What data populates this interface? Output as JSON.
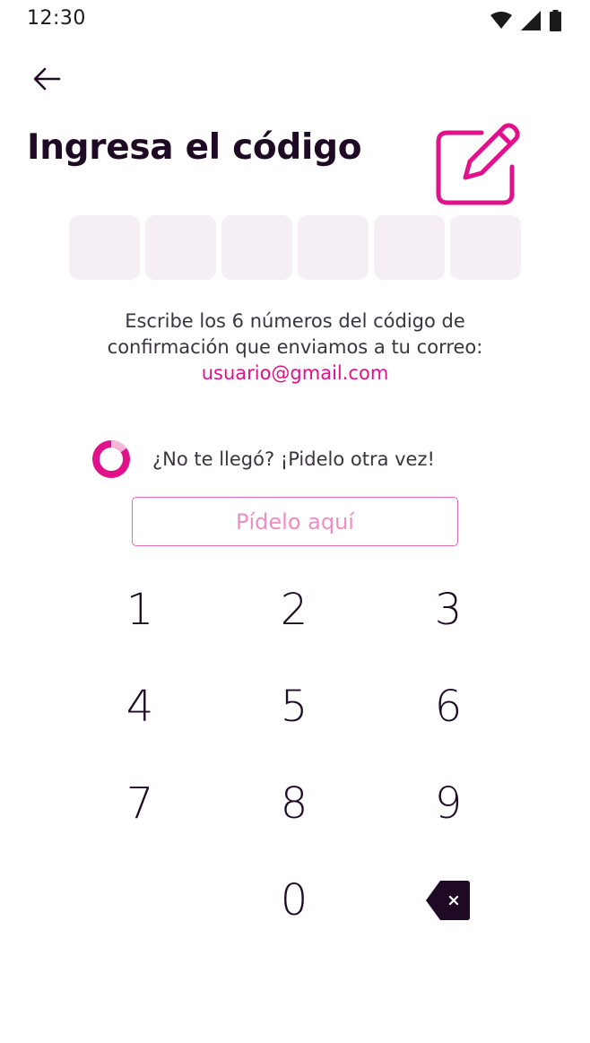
{
  "status_bar": {
    "time": "12:30",
    "icons": [
      "wifi-icon",
      "signal-icon",
      "battery-icon"
    ]
  },
  "header": {
    "back_icon": "arrow-left-icon",
    "title": "Ingresa el código",
    "illustration_icon": "edit-pencil-icon"
  },
  "code_input": {
    "length": 6,
    "values": [
      "",
      "",
      "",
      "",
      "",
      ""
    ]
  },
  "instructions": {
    "line1": "Escribe los 6 números del código de",
    "line2": "confirmación que enviamos a tu correo:",
    "email": "usuario@gmail.com"
  },
  "resend": {
    "countdown_icon": "countdown-ring-icon",
    "text": "¿No te llegó? ¡Pidelo otra vez!",
    "button_label": "Pídelo aquí"
  },
  "keypad": {
    "keys": [
      "1",
      "2",
      "3",
      "4",
      "5",
      "6",
      "7",
      "8",
      "9",
      "",
      "0"
    ],
    "delete_icon": "backspace-icon"
  },
  "colors": {
    "accent": "#e0118a",
    "accent_light": "#ef8cc3",
    "box_background": "#f6eef5",
    "text_dark": "#1f0a26",
    "text_body": "#3a3340"
  }
}
